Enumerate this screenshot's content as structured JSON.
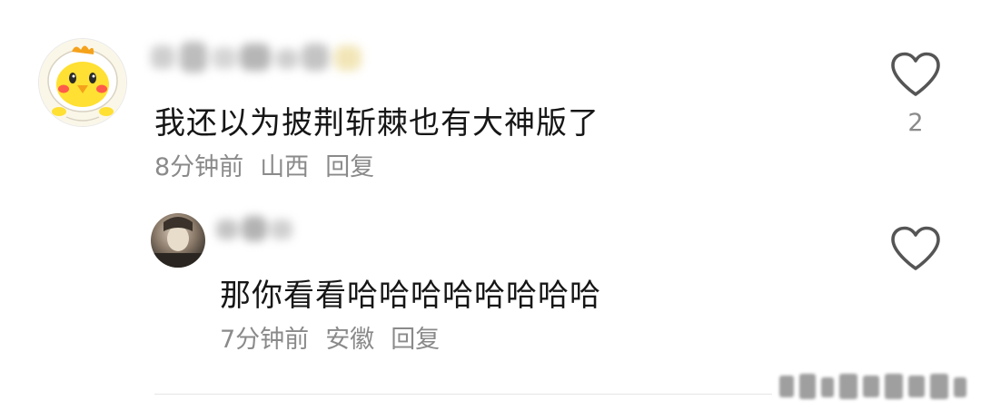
{
  "comments": [
    {
      "text": "我还以为披荆斩棘也有大神版了",
      "time": "8分钟前",
      "location": "山西",
      "reply_label": "回复",
      "like_count": "2",
      "avatar_icon": "yellow-chick-avatar-icon"
    },
    {
      "text": "那你看看哈哈哈哈哈哈哈哈",
      "time": "7分钟前",
      "location": "安徽",
      "reply_label": "回复",
      "like_count": "",
      "avatar_icon": "photo-avatar-icon"
    }
  ],
  "colors": {
    "text": "#161616",
    "meta": "#8a8a8a",
    "chick_yellow": "#ffe033",
    "chick_beak": "#f5a21b",
    "chick_cheek": "#ff5a4a"
  }
}
